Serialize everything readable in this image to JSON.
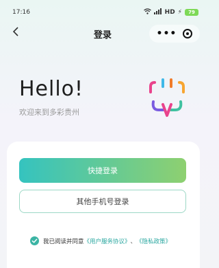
{
  "status_bar": {
    "time": "17:16",
    "network": "HD",
    "battery": "79"
  },
  "nav": {
    "title": "登录"
  },
  "hero": {
    "greeting": "Hello!",
    "subtitle": "欢迎来到多彩贵州"
  },
  "actions": {
    "quick_login": "快捷登录",
    "other_phone_login": "其他手机号登录"
  },
  "agreement": {
    "prefix": "我已阅读并同意",
    "user_agreement": "《用户服务协议》",
    "separator": "、",
    "privacy_policy": "《隐私政策》",
    "checked": true
  },
  "colors": {
    "accent": "#2aa7a0",
    "gradient_start": "#35c3bf",
    "gradient_end": "#8ed070"
  },
  "icons": [
    "back-arrow-icon",
    "more-icon",
    "target-icon",
    "checkmark-icon",
    "wifi-icon",
    "signal-icon",
    "battery-icon",
    "app-logo-icon"
  ]
}
